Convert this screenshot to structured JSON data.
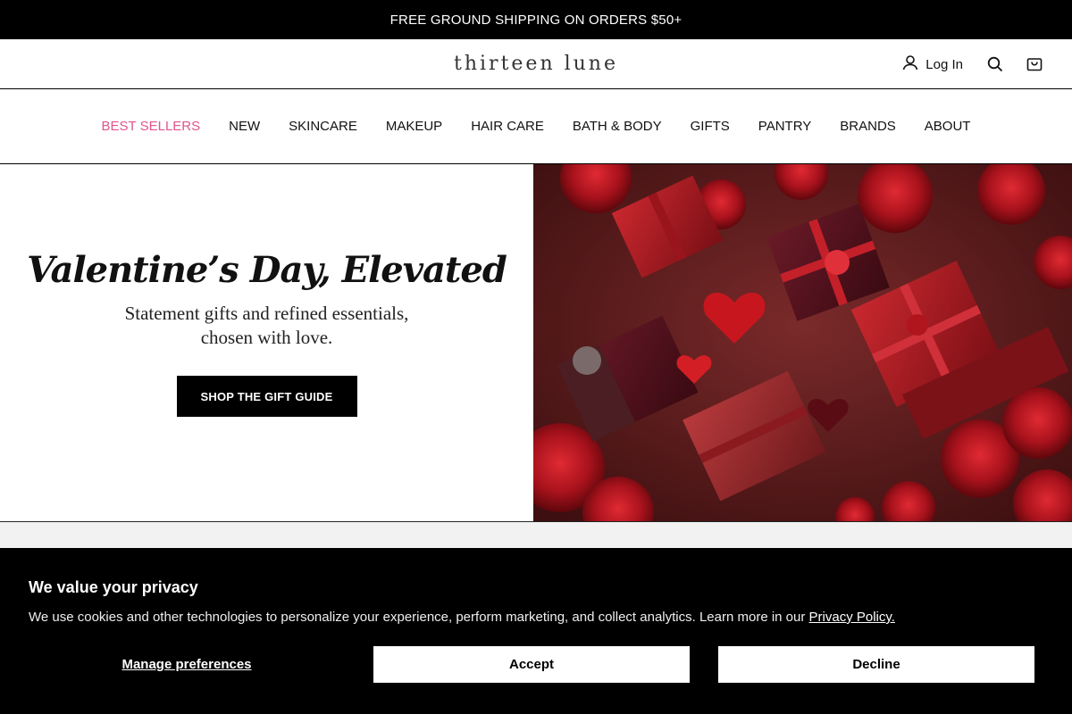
{
  "announcement": "FREE GROUND SHIPPING ON ORDERS $50+",
  "header": {
    "logo": "thirteen lune",
    "login_label": "Log In",
    "icons": {
      "account": "user-icon",
      "search": "search-icon",
      "cart": "bag-icon"
    }
  },
  "nav": {
    "items": [
      {
        "label": "BEST SELLERS",
        "active": true
      },
      {
        "label": "NEW"
      },
      {
        "label": "SKINCARE"
      },
      {
        "label": "MAKEUP"
      },
      {
        "label": "HAIR CARE"
      },
      {
        "label": "BATH & BODY"
      },
      {
        "label": "GIFTS"
      },
      {
        "label": "PANTRY"
      },
      {
        "label": "BRANDS"
      },
      {
        "label": "ABOUT"
      }
    ],
    "active_color": "#e0558b"
  },
  "hero": {
    "title": "Valentine’s Day, Elevated",
    "subtitle_line1": "Statement gifts and refined essentials,",
    "subtitle_line2": "chosen with love.",
    "cta_label": "SHOP THE GIFT GUIDE"
  },
  "cookie_banner": {
    "title": "We value your privacy",
    "body": "We use cookies and other technologies to personalize your experience, perform marketing, and collect analytics. Learn more in our ",
    "link_label": "Privacy Policy.",
    "manage_label": "Manage preferences",
    "accept_label": "Accept",
    "decline_label": "Decline"
  },
  "colors": {
    "brand_black": "#000000",
    "accent_pink": "#e0558b",
    "hero_red": "#8b1a1f"
  }
}
